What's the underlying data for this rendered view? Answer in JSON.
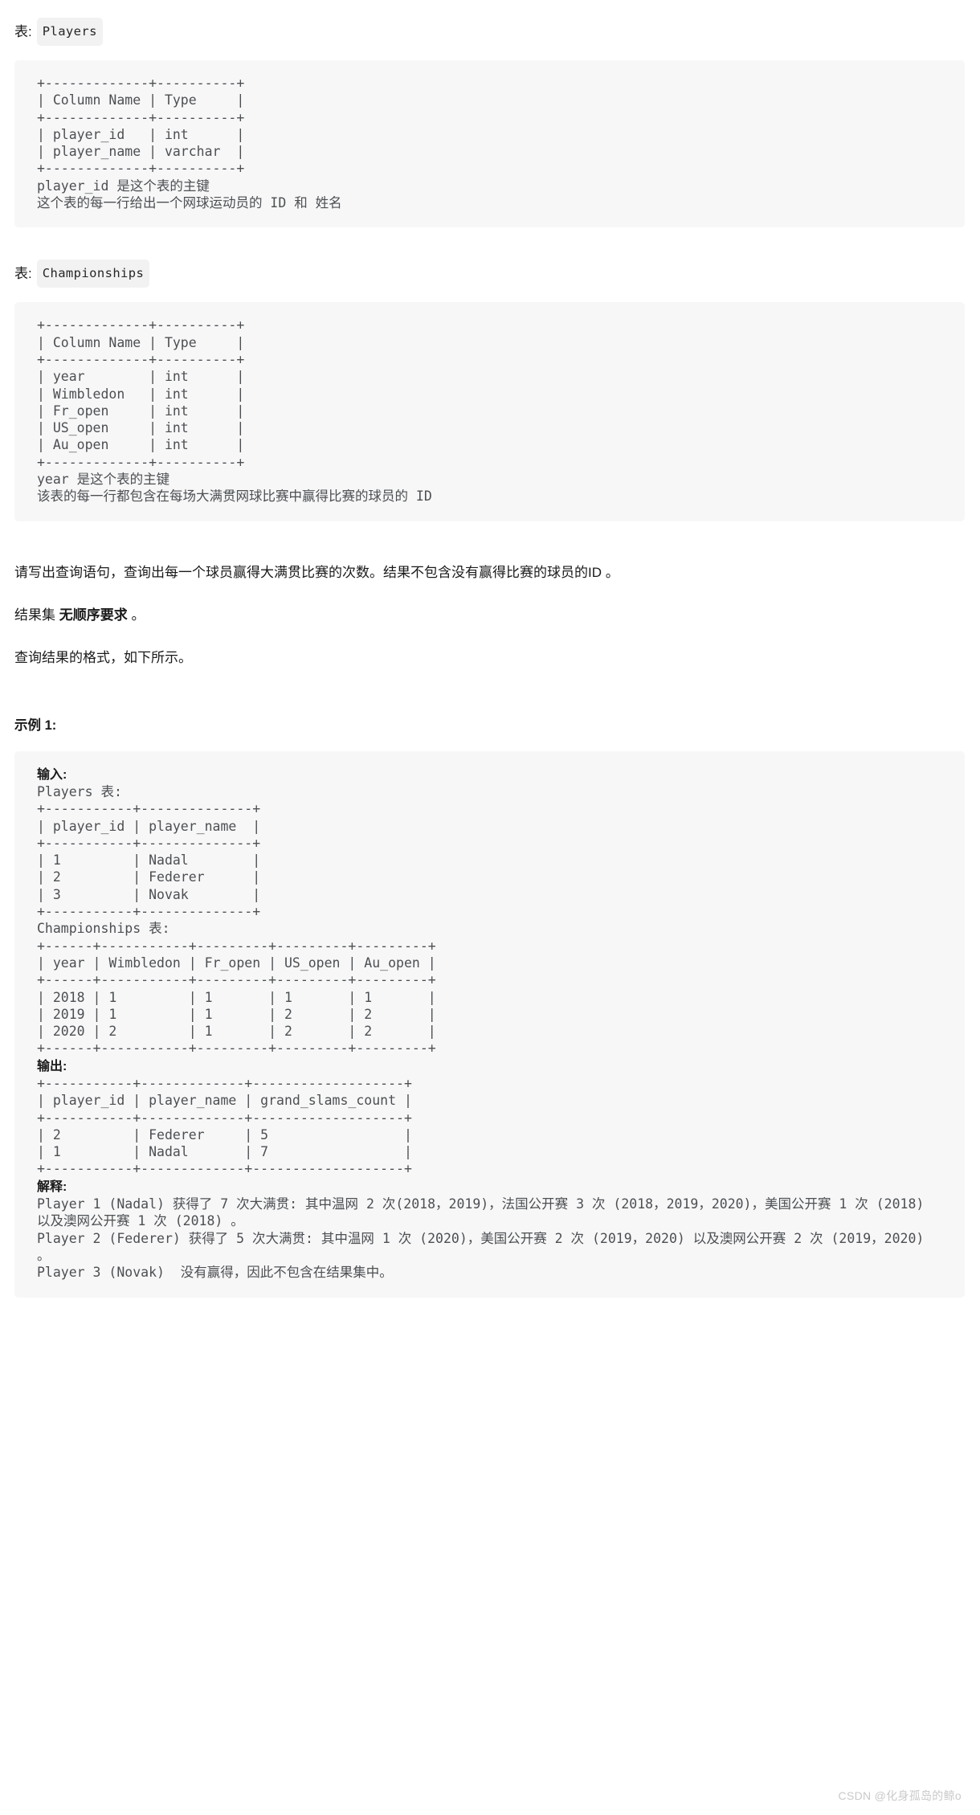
{
  "tables": [
    {
      "caption_label": "表:",
      "caption_name": "Players",
      "schema_ascii": "+-------------+----------+\n| Column Name | Type     |\n+-------------+----------+\n| player_id   | int      |\n| player_name | varchar  |\n+-------------+----------+",
      "notes": "player_id 是这个表的主键\n这个表的每一行给出一个网球运动员的 ID 和 姓名",
      "columns": [
        {
          "name": "player_id",
          "type": "int"
        },
        {
          "name": "player_name",
          "type": "varchar"
        }
      ]
    },
    {
      "caption_label": "表:",
      "caption_name": "Championships",
      "schema_ascii": "+-------------+----------+\n| Column Name | Type     |\n+-------------+----------+\n| year        | int      |\n| Wimbledon   | int      |\n| Fr_open     | int      |\n| US_open     | int      |\n| Au_open     | int      |\n+-------------+----------+",
      "notes": "year 是这个表的主键\n该表的每一行都包含在每场大满贯网球比赛中赢得比赛的球员的 ID",
      "columns": [
        {
          "name": "year",
          "type": "int"
        },
        {
          "name": "Wimbledon",
          "type": "int"
        },
        {
          "name": "Fr_open",
          "type": "int"
        },
        {
          "name": "US_open",
          "type": "int"
        },
        {
          "name": "Au_open",
          "type": "int"
        }
      ]
    }
  ],
  "question": "请写出查询语句，查询出每一个球员赢得大满贯比赛的次数。结果不包含没有赢得比赛的球员的ID 。",
  "order_note_prefix": "结果集 ",
  "order_note_bold": "无顺序要求",
  "order_note_suffix": " 。",
  "format_note": "查询结果的格式，如下所示。",
  "example_heading": "示例 1:",
  "example": {
    "input_label": "输入:",
    "players_label": "Players 表:",
    "players_ascii": "+-----------+--------------+\n| player_id | player_name  |\n+-----------+--------------+\n| 1         | Nadal        |\n| 2         | Federer      |\n| 3         | Novak        |\n+-----------+--------------+",
    "championships_label": "Championships 表:",
    "championships_ascii": "+------+-----------+---------+---------+---------+\n| year | Wimbledon | Fr_open | US_open | Au_open |\n+------+-----------+---------+---------+---------+\n| 2018 | 1         | 1       | 1       | 1       |\n| 2019 | 1         | 1       | 2       | 2       |\n| 2020 | 2         | 1       | 2       | 2       |\n+------+-----------+---------+---------+---------+",
    "output_label": "输出:",
    "output_ascii": "+-----------+-------------+-------------------+\n| player_id | player_name | grand_slams_count |\n+-----------+-------------+-------------------+\n| 2         | Federer     | 5                 |\n| 1         | Nadal       | 7                 |\n+-----------+-------------+-------------------+",
    "explain_label": "解释:",
    "explain_lines": "Player 1 (Nadal) 获得了 7 次大满贯: 其中温网 2 次(2018，2019)，法国公开赛 3 次 (2018，2019，2020)，美国公开赛 1 次 (2018)以及澳网公开赛 1 次 (2018) 。\nPlayer 2 (Federer) 获得了 5 次大满贯: 其中温网 1 次 (2020)，美国公开赛 2 次 (2019，2020) 以及澳网公开赛 2 次 (2019，2020) 。\nPlayer 3 (Novak)  没有赢得，因此不包含在结果集中。",
    "players_rows": [
      {
        "player_id": "1",
        "player_name": "Nadal"
      },
      {
        "player_id": "2",
        "player_name": "Federer"
      },
      {
        "player_id": "3",
        "player_name": "Novak"
      }
    ],
    "championships_rows": [
      {
        "year": "2018",
        "Wimbledon": "1",
        "Fr_open": "1",
        "US_open": "1",
        "Au_open": "1"
      },
      {
        "year": "2019",
        "Wimbledon": "1",
        "Fr_open": "1",
        "US_open": "2",
        "Au_open": "2"
      },
      {
        "year": "2020",
        "Wimbledon": "2",
        "Fr_open": "1",
        "US_open": "2",
        "Au_open": "2"
      }
    ],
    "output_rows": [
      {
        "player_id": "2",
        "player_name": "Federer",
        "grand_slams_count": "5"
      },
      {
        "player_id": "1",
        "player_name": "Nadal",
        "grand_slams_count": "7"
      }
    ]
  },
  "watermark": "CSDN @化身孤岛的鲸o"
}
